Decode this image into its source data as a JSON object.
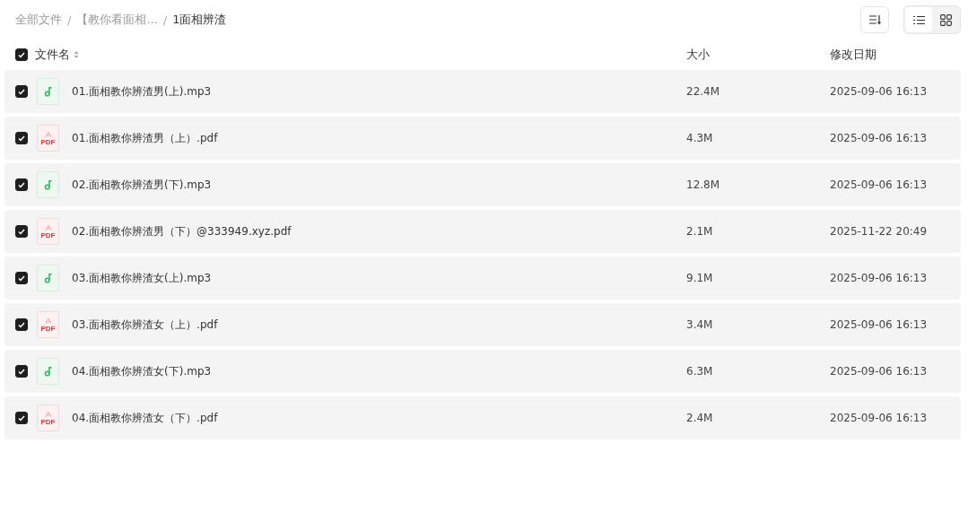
{
  "breadcrumb": [
    {
      "label": "全部文件",
      "current": false
    },
    {
      "separator": "/",
      "label": "【教你看面相...",
      "current": false
    },
    {
      "separator": "/",
      "label": "1面相辨渣",
      "current": true
    }
  ],
  "view_modes": [
    {
      "kind": "list",
      "selected": true
    },
    {
      "kind": "grid",
      "selected": false
    }
  ],
  "header": {
    "checked": true,
    "columns": [
      "文件名",
      "大小",
      "修改日期"
    ]
  },
  "files": [
    {
      "kind": "audio",
      "name": "01.面相教你辨渣男(上).mp3",
      "size": "22.4M",
      "modified": "2025-09-06 16:13",
      "checked": true
    },
    {
      "kind": "pdf",
      "icon_text": "PDF",
      "name": "01.面相教你辨渣男（上）.pdf",
      "size": "4.3M",
      "modified": "2025-09-06 16:13",
      "checked": true
    },
    {
      "kind": "audio",
      "name": "02.面相教你辨渣男(下).mp3",
      "size": "12.8M",
      "modified": "2025-09-06 16:13",
      "checked": true
    },
    {
      "kind": "pdf",
      "icon_text": "PDF",
      "name": "02.面相教你辨渣男（下）@333949.xyz.pdf",
      "size": "2.1M",
      "modified": "2025-11-22 20:49",
      "checked": true
    },
    {
      "kind": "audio",
      "name": "03.面相教你辨渣女(上).mp3",
      "size": "9.1M",
      "modified": "2025-09-06 16:13",
      "checked": true
    },
    {
      "kind": "pdf",
      "icon_text": "PDF",
      "name": "03.面相教你辨渣女（上）.pdf",
      "size": "3.4M",
      "modified": "2025-09-06 16:13",
      "checked": true
    },
    {
      "kind": "audio",
      "name": "04.面相教你辨渣女(下).mp3",
      "size": "6.3M",
      "modified": "2025-09-06 16:13",
      "checked": true
    },
    {
      "kind": "pdf",
      "icon_text": "PDF",
      "name": "04.面相教你辨渣女（下）.pdf",
      "size": "2.4M",
      "modified": "2025-09-06 16:13",
      "checked": true
    }
  ]
}
